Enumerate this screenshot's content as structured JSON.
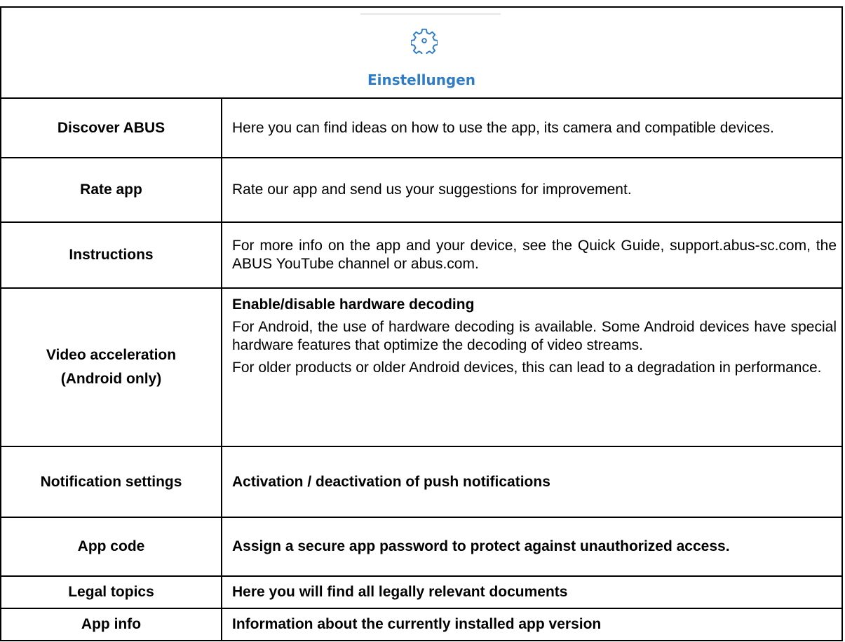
{
  "header": {
    "title": "Einstellungen",
    "icon": "gear-icon",
    "accent_color": "#2e7cc6"
  },
  "rows": [
    {
      "label": "Discover ABUS",
      "text": "Here you can find ideas on how to use the app, its camera and compatible devices."
    },
    {
      "label": "Rate app",
      "text": "Rate our app and send us your suggestions for improvement."
    },
    {
      "label": "Instructions",
      "text": "For more info on the app and your device, see the Quick Guide, support.abus-sc.com, the ABUS YouTube channel or abus.com."
    },
    {
      "label_line1": "Video acceleration",
      "label_line2": "(Android only)",
      "heading": "Enable/disable hardware decoding",
      "para1": "For Android, the use of hardware decoding is available. Some Android devices have special hardware features that optimize the decoding of video streams.",
      "para2": "For older products or older Android devices, this can lead to a degradation in performance."
    },
    {
      "label": "Notification settings",
      "text": "Activation / deactivation of push notifications"
    },
    {
      "label": "App code",
      "text": "Assign a secure app password to protect against unauthorized access."
    },
    {
      "label": "Legal topics",
      "text": "Here you will find all legally relevant documents"
    },
    {
      "label": "App info",
      "text": "Information about the currently installed app version"
    }
  ]
}
